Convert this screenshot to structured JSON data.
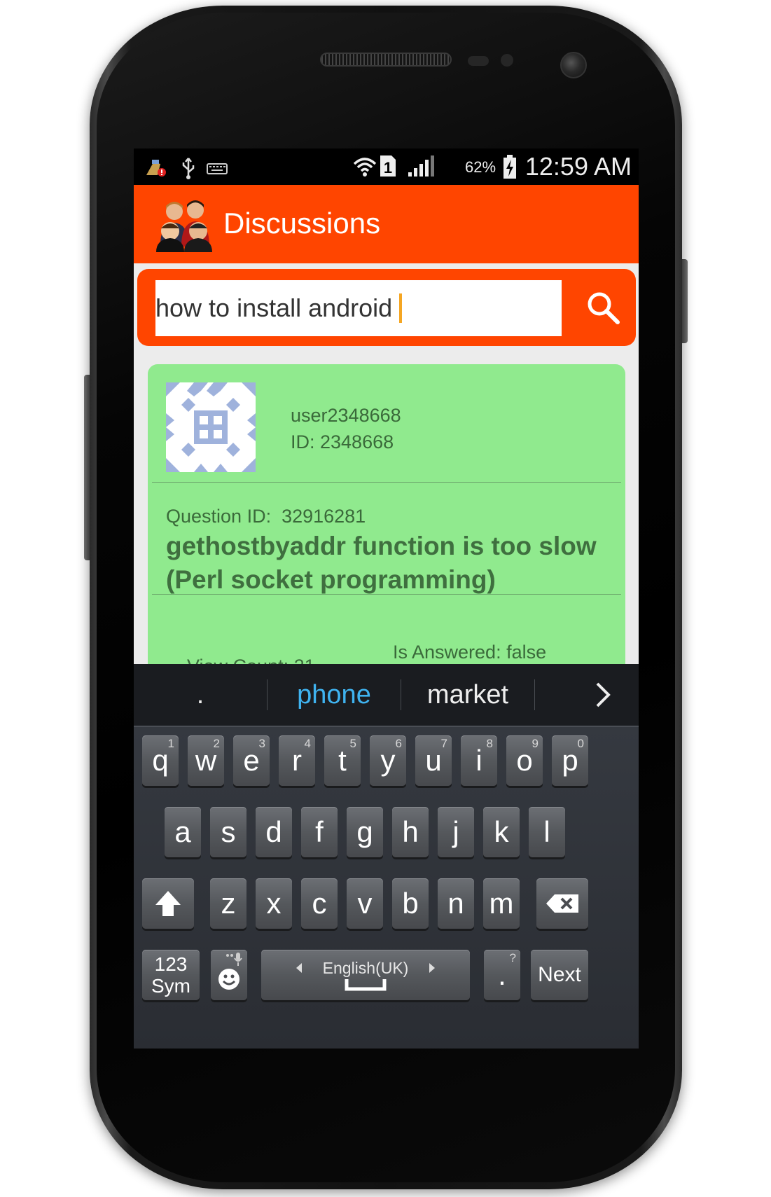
{
  "status_bar": {
    "icons": [
      "cleaner-notification-icon",
      "usb-icon",
      "keyboard-icon",
      "wifi-icon",
      "sim-1-icon",
      "signal-icon",
      "battery-charging-icon"
    ],
    "battery_percent": "62%",
    "time": "12:59 AM"
  },
  "action_bar": {
    "title": "Discussions",
    "logo_icon": "people-discussion-icon",
    "accent_color": "#ff4500"
  },
  "search": {
    "value": "how to install android",
    "button_icon": "search-icon"
  },
  "question": {
    "user_name": "user2348668",
    "user_id": "ID: 2348668",
    "question_id": "Question ID:  32916281",
    "title": "gethostbyaddr function is too slow (Perl socket programming)",
    "is_answered": "Is Answered: false",
    "view_count": "View Count: 21",
    "card_color": "#90ea8e"
  },
  "keyboard": {
    "suggestions": [
      ".",
      "phone",
      "market"
    ],
    "selected_suggestion": "phone",
    "row1": [
      {
        "label": "q",
        "hint": "1"
      },
      {
        "label": "w",
        "hint": "2"
      },
      {
        "label": "e",
        "hint": "3"
      },
      {
        "label": "r",
        "hint": "4"
      },
      {
        "label": "t",
        "hint": "5"
      },
      {
        "label": "y",
        "hint": "6"
      },
      {
        "label": "u",
        "hint": "7"
      },
      {
        "label": "i",
        "hint": "8"
      },
      {
        "label": "o",
        "hint": "9"
      },
      {
        "label": "p",
        "hint": "0"
      }
    ],
    "row2": [
      "a",
      "s",
      "d",
      "f",
      "g",
      "h",
      "j",
      "k",
      "l"
    ],
    "row3": [
      "z",
      "x",
      "c",
      "v",
      "b",
      "n",
      "m"
    ],
    "sym_line1": "123",
    "sym_line2": "Sym",
    "language": "English(UK)",
    "period": ".",
    "period_hint": "?",
    "next_label": "Next"
  }
}
